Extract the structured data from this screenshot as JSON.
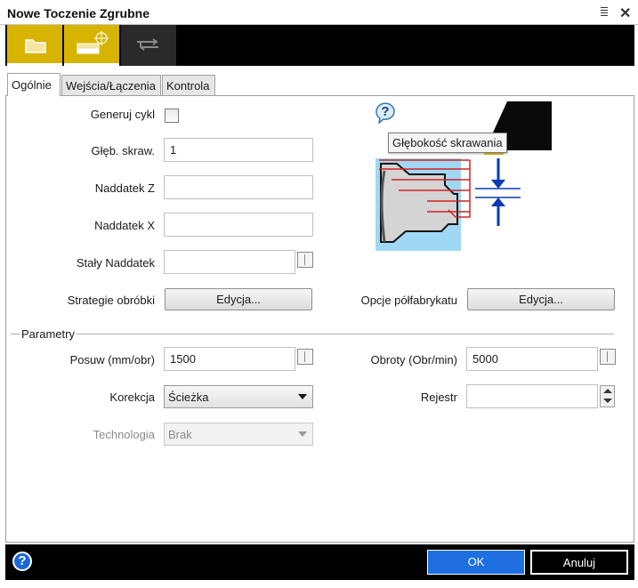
{
  "window": {
    "title": "Nowe Toczenie Zgrubne"
  },
  "toolbar": {
    "tools": [
      "folder-icon",
      "tool-position-icon",
      "transfer-arrows-icon"
    ]
  },
  "tabs": [
    "Ogólnie",
    "Wejścia/Łączenia",
    "Kontrola"
  ],
  "form": {
    "generuj_cykl": {
      "label": "Generuj cykl",
      "checked": false
    },
    "gleb_skraw": {
      "label": "Głęb. skraw.",
      "value": "1"
    },
    "naddatek_z": {
      "label": "Naddatek Z",
      "value": ""
    },
    "naddatek_x": {
      "label": "Naddatek X",
      "value": ""
    },
    "staly_naddatek": {
      "label": "Stały Naddatek",
      "value": ""
    },
    "strategie": {
      "label": "Strategie obróbki",
      "button": "Edycja..."
    },
    "opcje": {
      "label": "Opcje półfabrykatu",
      "button": "Edycja..."
    }
  },
  "illustration": {
    "tooltip": "Głębokość skrawania",
    "help_icon": "question-icon"
  },
  "parametry": {
    "group_label": "Parametry",
    "posuw": {
      "label": "Posuw (mm/obr)",
      "value": "1500"
    },
    "obroty": {
      "label": "Obroty (Obr/min)",
      "value": "5000"
    },
    "korekcja": {
      "label": "Korekcja",
      "value": "Ścieżka"
    },
    "rejestr": {
      "label": "Rejestr",
      "value": ""
    },
    "technologia": {
      "label": "Technologia",
      "value": "Brak"
    }
  },
  "footer": {
    "ok": "OK",
    "cancel": "Anuluj",
    "accent": "#1e6fe0"
  }
}
